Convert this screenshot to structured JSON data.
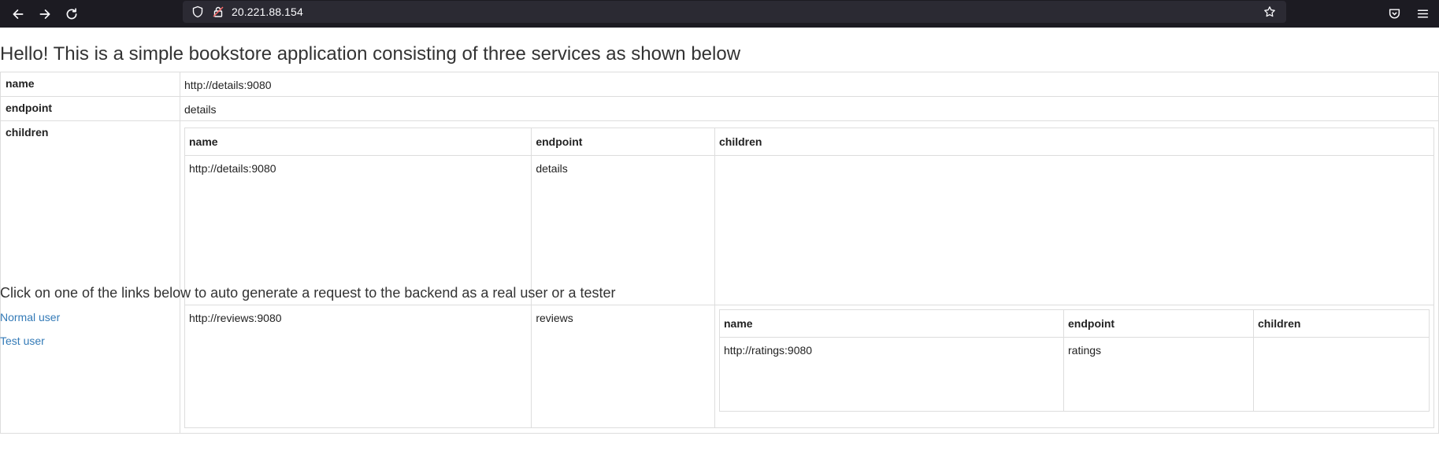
{
  "browser": {
    "url": "20.221.88.154"
  },
  "page": {
    "heading": "Hello! This is a simple bookstore application consisting of three services as shown below",
    "top_table": {
      "name_key": "name",
      "name_value": "http://details:9080",
      "endpoint_key": "endpoint",
      "endpoint_value": "details",
      "children_key": "children"
    },
    "children_table": {
      "headers": [
        "name",
        "endpoint",
        "children"
      ],
      "rows": [
        {
          "name": "http://details:9080",
          "endpoint": "details"
        },
        {
          "name": "http://reviews:9080",
          "endpoint": "reviews"
        }
      ]
    },
    "nested_children_table": {
      "headers": [
        "name",
        "endpoint",
        "children"
      ],
      "rows": [
        {
          "name": "http://ratings:9080",
          "endpoint": "ratings",
          "children": ""
        }
      ]
    },
    "links_heading": "Click on one of the links below to auto generate a request to the backend as a real user or a tester",
    "links": [
      "Normal user",
      "Test user"
    ]
  }
}
